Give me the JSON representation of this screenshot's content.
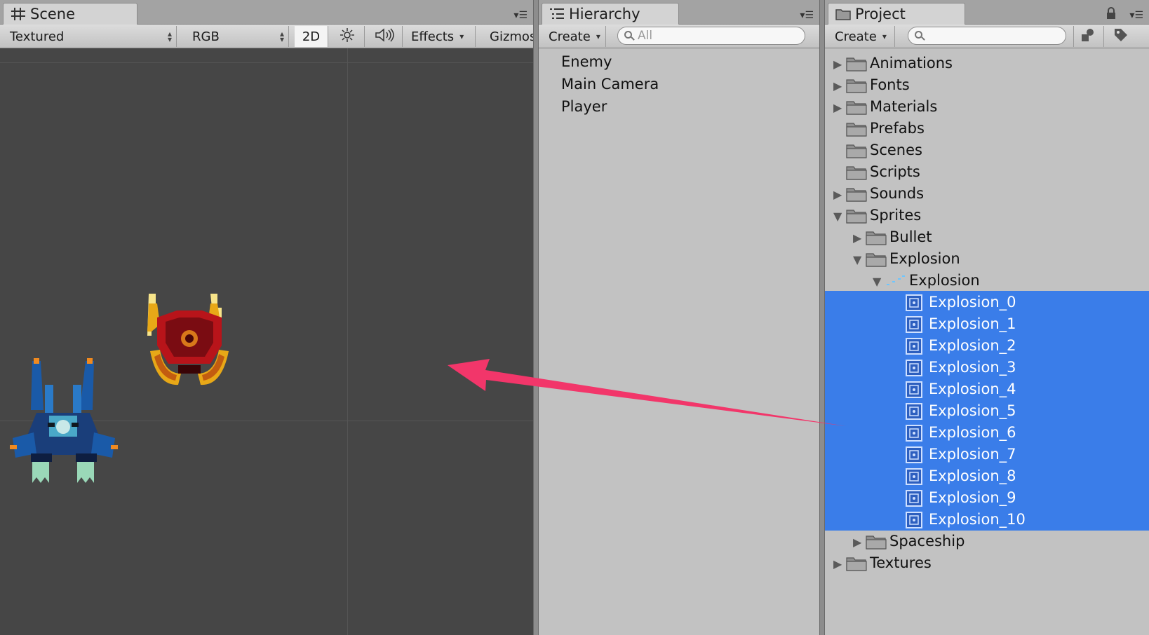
{
  "scene": {
    "tab_title": "Scene",
    "draw_mode": "Textured",
    "color_mode": "RGB",
    "mode_2d": "2D",
    "effects_label": "Effects",
    "gizmos_label": "Gizmos"
  },
  "hierarchy": {
    "tab_title": "Hierarchy",
    "create_label": "Create",
    "search_placeholder": "All",
    "items": [
      "Enemy",
      "Main Camera",
      "Player"
    ]
  },
  "project": {
    "tab_title": "Project",
    "create_label": "Create",
    "search_placeholder": "",
    "tree": [
      {
        "label": "Animations",
        "depth": 0,
        "kind": "folder",
        "expander": "collapsed",
        "selected": false
      },
      {
        "label": "Fonts",
        "depth": 0,
        "kind": "folder",
        "expander": "collapsed",
        "selected": false
      },
      {
        "label": "Materials",
        "depth": 0,
        "kind": "folder",
        "expander": "collapsed",
        "selected": false
      },
      {
        "label": "Prefabs",
        "depth": 0,
        "kind": "folder",
        "expander": "none",
        "selected": false
      },
      {
        "label": "Scenes",
        "depth": 0,
        "kind": "folder",
        "expander": "none",
        "selected": false
      },
      {
        "label": "Scripts",
        "depth": 0,
        "kind": "folder",
        "expander": "none",
        "selected": false
      },
      {
        "label": "Sounds",
        "depth": 0,
        "kind": "folder",
        "expander": "collapsed",
        "selected": false
      },
      {
        "label": "Sprites",
        "depth": 0,
        "kind": "folder",
        "expander": "expanded",
        "selected": false
      },
      {
        "label": "Bullet",
        "depth": 1,
        "kind": "folder",
        "expander": "collapsed",
        "selected": false
      },
      {
        "label": "Explosion",
        "depth": 1,
        "kind": "folder",
        "expander": "expanded",
        "selected": false
      },
      {
        "label": "Explosion",
        "depth": 2,
        "kind": "spritesheet",
        "expander": "expanded",
        "selected": false
      },
      {
        "label": "Explosion_0",
        "depth": 3,
        "kind": "sprite",
        "expander": "none",
        "selected": true
      },
      {
        "label": "Explosion_1",
        "depth": 3,
        "kind": "sprite",
        "expander": "none",
        "selected": true
      },
      {
        "label": "Explosion_2",
        "depth": 3,
        "kind": "sprite",
        "expander": "none",
        "selected": true
      },
      {
        "label": "Explosion_3",
        "depth": 3,
        "kind": "sprite",
        "expander": "none",
        "selected": true
      },
      {
        "label": "Explosion_4",
        "depth": 3,
        "kind": "sprite",
        "expander": "none",
        "selected": true
      },
      {
        "label": "Explosion_5",
        "depth": 3,
        "kind": "sprite",
        "expander": "none",
        "selected": true
      },
      {
        "label": "Explosion_6",
        "depth": 3,
        "kind": "sprite",
        "expander": "none",
        "selected": true
      },
      {
        "label": "Explosion_7",
        "depth": 3,
        "kind": "sprite",
        "expander": "none",
        "selected": true
      },
      {
        "label": "Explosion_8",
        "depth": 3,
        "kind": "sprite",
        "expander": "none",
        "selected": true
      },
      {
        "label": "Explosion_9",
        "depth": 3,
        "kind": "sprite",
        "expander": "none",
        "selected": true
      },
      {
        "label": "Explosion_10",
        "depth": 3,
        "kind": "sprite",
        "expander": "none",
        "selected": true
      },
      {
        "label": "Spaceship",
        "depth": 1,
        "kind": "folder",
        "expander": "collapsed",
        "selected": false
      },
      {
        "label": "Textures",
        "depth": 0,
        "kind": "folder",
        "expander": "collapsed",
        "selected": false
      }
    ]
  },
  "colors": {
    "selection": "#3a7de9",
    "scene_bg": "#464646",
    "arrow": "#f2366a"
  },
  "icons": {
    "scene_tab": "grid-icon",
    "hierarchy_tab": "list-icon",
    "project_tab": "folder-icon",
    "lighting": "sun-icon",
    "audio": "speaker-icon",
    "project_filters": [
      "shapes-icon",
      "tag-icon"
    ],
    "lock": "lock-icon"
  }
}
